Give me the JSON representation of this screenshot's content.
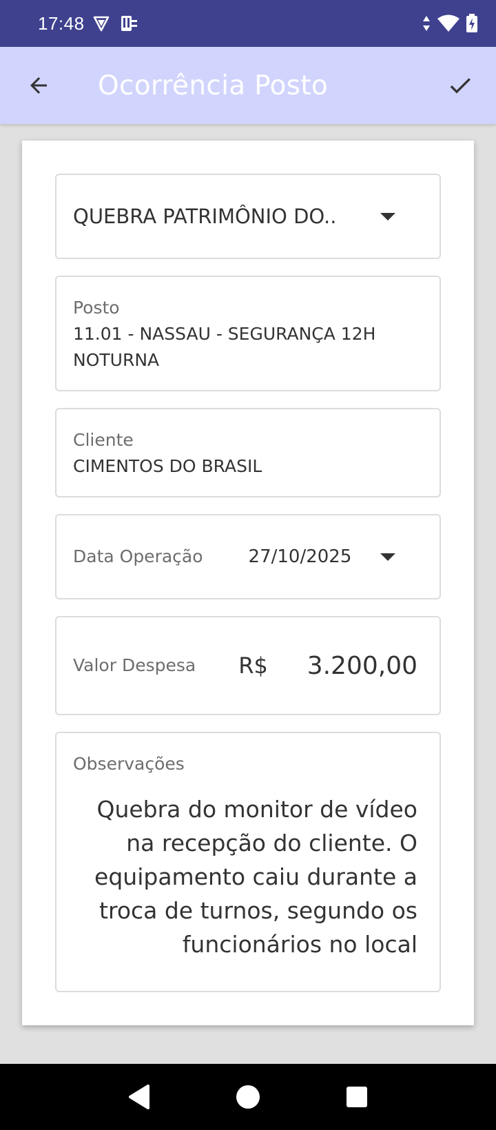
{
  "status_bar": {
    "time": "17:48"
  },
  "app_bar": {
    "title": "Ocorrência Posto"
  },
  "form": {
    "occurrence_type": "QUEBRA PATRIMÔNIO DO..",
    "posto": {
      "label": "Posto",
      "value": "11.01 - NASSAU - SEGURANÇA 12H NOTURNA"
    },
    "cliente": {
      "label": "Cliente",
      "value": "CIMENTOS DO BRASIL"
    },
    "data_operacao": {
      "label": "Data Operação",
      "value": "27/10/2025"
    },
    "valor_despesa": {
      "label": "Valor Despesa",
      "currency": "R$",
      "value": "3.200,00"
    },
    "observacoes": {
      "label": "Observações",
      "value": "Quebra do monitor de vídeo na recepção do cliente. O equipamento caiu durante a troca de turnos, segundo os funcionários no local"
    }
  },
  "icons": {
    "back": "arrow-back-icon",
    "confirm": "check-icon",
    "nav_back": "triangle-back-icon",
    "nav_home": "circle-home-icon",
    "nav_recents": "square-recents-icon"
  },
  "colors": {
    "status_bar": "#3f418f",
    "app_bar": "#d1d4fd",
    "title_text": "#ffffff",
    "background": "#e0e0e0"
  }
}
